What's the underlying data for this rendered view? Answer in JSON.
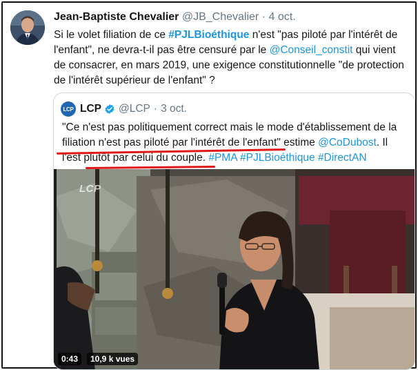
{
  "tweet": {
    "author_name": "Jean-Baptiste Chevalier",
    "author_handle": "@JB_Chevalier",
    "separator": "·",
    "time": "4 oct.",
    "text_part1": "Si le volet filiation de ce ",
    "hashtag": "#PJLBioéthique",
    "text_part2": " n'est \"pas piloté par l'intérêt de l'enfant\", ne devra-t-il pas être censuré par le ",
    "mention": "@Conseil_constit",
    "text_part3": " qui vient de consacrer, en mars 2019, une exigence constitutionnelle \"de protection de l'intérêt supérieur de l'enfant\" ?"
  },
  "quote": {
    "logo_text": "LCP",
    "author_name": "LCP",
    "author_handle": "@LCP",
    "separator": "·",
    "time": "3 oct.",
    "text_part1": "\"Ce n'est pas politiquement correct mais le mode d'établissement de la filiation n'est pas piloté par l'intérêt de l'enfant\" estime ",
    "mention": "@CoDubost",
    "text_part2": ". Il l'est plutôt par celui du couple. ",
    "hashtags": "#PMA #PJLBioéthique #DirectAN",
    "media": {
      "watermark": "LCP",
      "duration": "0:43",
      "views": "10,9 k vues"
    }
  },
  "colors": {
    "link": "#1b95e0",
    "underline_highlight": "#e01818",
    "verified": "#1da1f2"
  }
}
